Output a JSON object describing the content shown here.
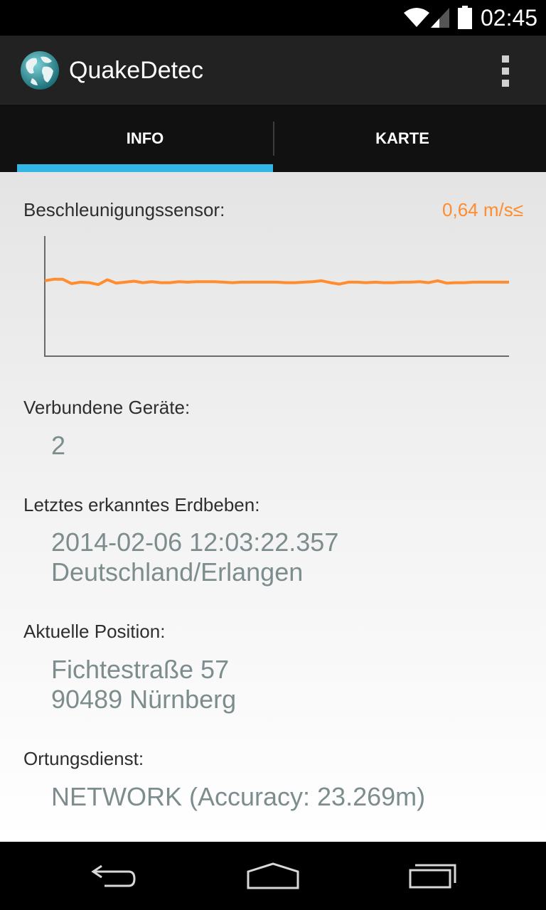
{
  "status_bar": {
    "time": "02:45"
  },
  "action_bar": {
    "title": "QuakeDetec"
  },
  "tabs": [
    {
      "label": "INFO",
      "selected": true
    },
    {
      "label": "KARTE",
      "selected": false
    }
  ],
  "accelerometer": {
    "label": "Beschleunigungssensor:",
    "value": "0,64 m/s≤"
  },
  "chart_data": {
    "type": "line",
    "title": "",
    "xlabel": "",
    "ylabel": "",
    "color": "#ff8c2e",
    "series": [
      {
        "values": [
          0.64,
          0.7,
          0.7,
          0.52,
          0.58,
          0.56,
          0.48,
          0.68,
          0.54,
          0.58,
          0.62,
          0.56,
          0.6,
          0.56,
          0.56,
          0.6,
          0.58,
          0.6,
          0.6,
          0.6,
          0.58,
          0.56,
          0.58,
          0.58,
          0.58,
          0.58,
          0.58,
          0.56,
          0.56,
          0.58,
          0.6,
          0.64,
          0.56,
          0.5,
          0.58,
          0.58,
          0.56,
          0.58,
          0.56,
          0.56,
          0.58,
          0.58,
          0.6,
          0.56,
          0.64,
          0.54,
          0.56,
          0.56,
          0.58,
          0.58,
          0.58,
          0.58,
          0.58
        ]
      }
    ],
    "ylim": [
      -2.5,
      2.5
    ],
    "grid": false
  },
  "connected_devices": {
    "label": "Verbundene Geräte:",
    "value": "2"
  },
  "last_quake": {
    "label": "Letztes erkanntes Erdbeben:",
    "timestamp": "2014-02-06 12:03:22.357",
    "location": "Deutschland/Erlangen"
  },
  "current_position": {
    "label": "Aktuelle Position:",
    "street": "Fichtestraße 57",
    "city": "90489 Nürnberg"
  },
  "location_service": {
    "label": "Ortungsdienst:",
    "value": "NETWORK (Accuracy: 23.269m)"
  },
  "icons": {
    "wifi": "wifi-icon",
    "signal": "signal-icon",
    "battery": "battery-icon",
    "app": "globe-icon",
    "overflow": "overflow-menu-icon",
    "back": "back-icon",
    "home": "home-icon",
    "recents": "recents-icon"
  },
  "colors": {
    "accent": "#33b5e5",
    "sensor": "#ff8c2e",
    "value_text": "#7d8c8d"
  }
}
